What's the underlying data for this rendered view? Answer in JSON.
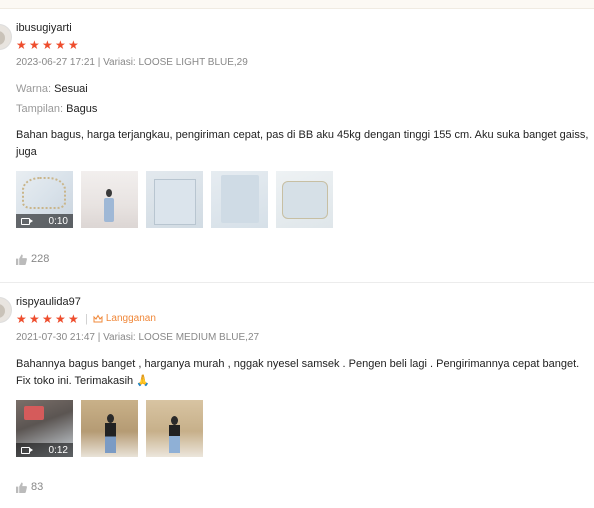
{
  "reviews": [
    {
      "username": "ibusugiyarti",
      "rating": 5,
      "meta": "2023-06-27 17:21 | Variasi: LOOSE LIGHT BLUE,29",
      "attributes": [
        {
          "key": "Warna:",
          "value": "Sesuai"
        },
        {
          "key": "Tampilan:",
          "value": "Bagus"
        }
      ],
      "body": "Bahan bagus, harga terjangkau, pengiriman cepat, pas di BB aku 45kg dengan tinggi 155 cm. Aku suka banget gaiss, juga",
      "video_duration": "0:10",
      "likes": "228"
    },
    {
      "username": "rispyaulida97",
      "rating": 5,
      "badge": "Langganan",
      "meta": "2021-07-30 21:47 | Variasi: LOOSE MEDIUM BLUE,27",
      "body": "Bahannya bagus banget , harganya murah , nggak nyesel samsek . Pengen beli lagi . Pengirimannya cepat banget. Fix toko ini. Terimakasih 🙏",
      "video_duration": "0:12",
      "likes": "83"
    }
  ],
  "colors": {
    "star": "#ee4d2d",
    "badge": "#f0883a",
    "muted": "#888888"
  }
}
